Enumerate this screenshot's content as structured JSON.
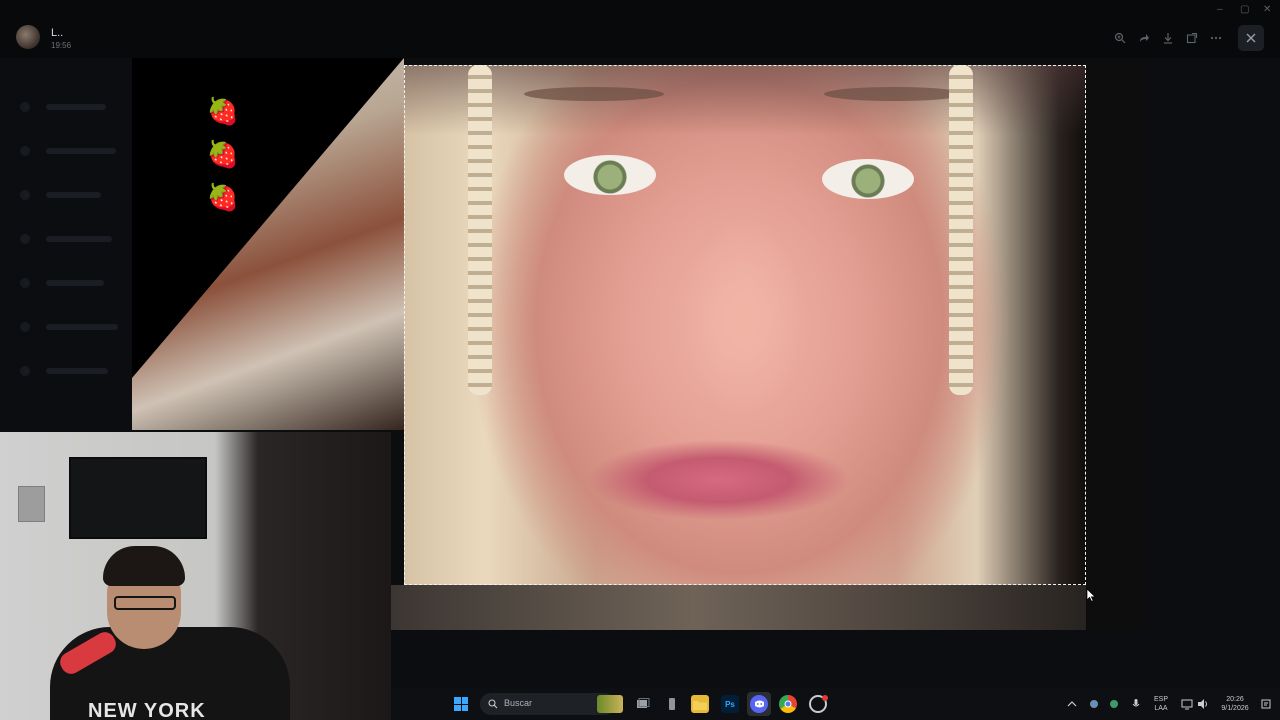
{
  "viewer": {
    "sender_name": "L..",
    "sender_time": "19:56",
    "toolbar": {
      "zoom_icon": "zoom-in-icon",
      "forward_icon": "forward-icon",
      "download_icon": "download-icon",
      "external_icon": "open-external-icon",
      "more_icon": "more-icon",
      "close_icon": "close-icon"
    },
    "window_controls": [
      "–",
      "▢",
      "✕"
    ]
  },
  "stickers": [
    "🍓",
    "🍓",
    "🍓"
  ],
  "webcam": {
    "shirt_text": "NEW YORK"
  },
  "taskbar": {
    "search_placeholder": "Buscar",
    "apps": [
      "file-explorer",
      "photoshop",
      "discord",
      "chrome",
      "extra-app"
    ],
    "photoshop_label": "Ps",
    "tray": {
      "language_top": "ESP",
      "language_bottom": "LAA",
      "time": "20:26",
      "date": "9/1/2026"
    }
  },
  "colors": {
    "accent": "#3ba7ff",
    "discord": "#5865f2",
    "photoshop": "#31a8ff"
  }
}
